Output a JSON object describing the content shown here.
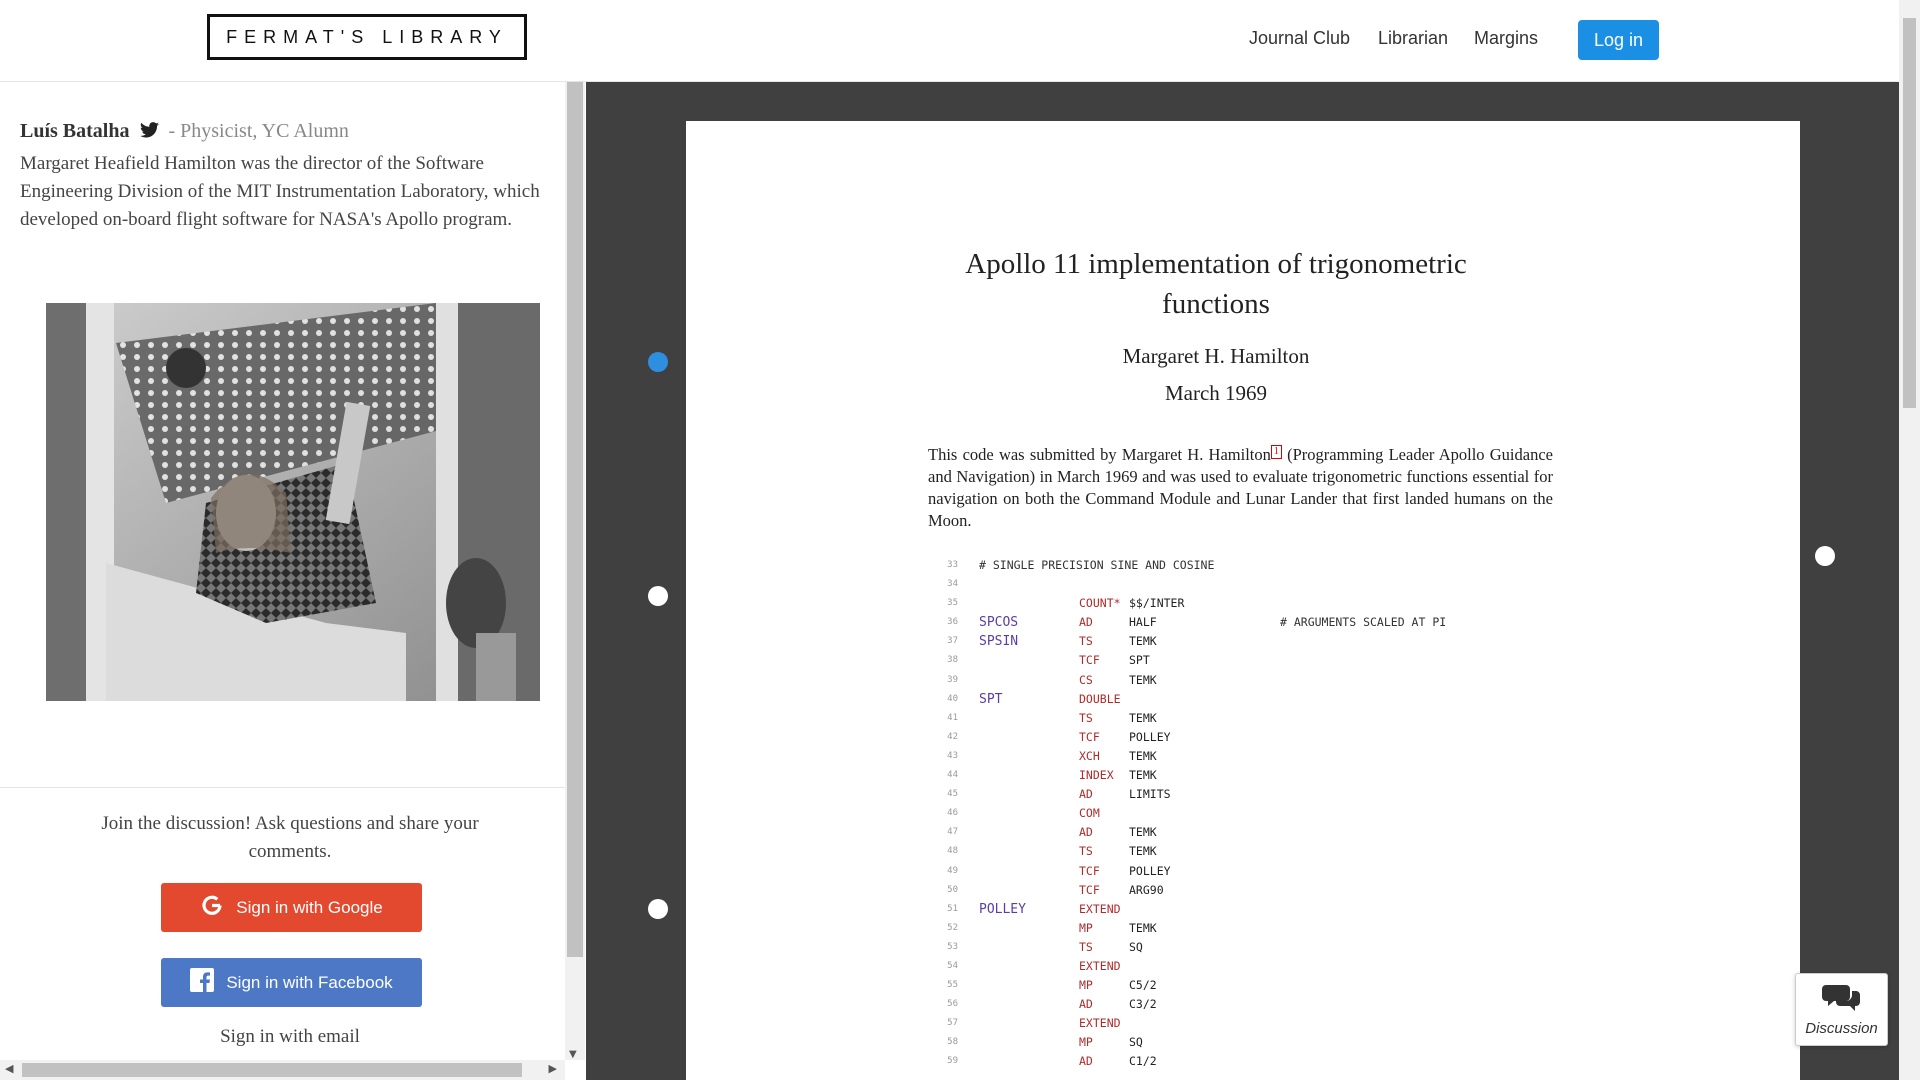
{
  "header": {
    "logo": "FERMAT'S LIBRARY",
    "nav": [
      "Journal Club",
      "Librarian",
      "Margins"
    ],
    "login": "Log in"
  },
  "sidebar": {
    "author_name": "Luís Batalha",
    "author_role": "- Physicist, YC Alumn",
    "bio": "Margaret Heafield Hamilton was the director of the Software Engineering Division of the MIT Instrumentation Laboratory, which developed on-board flight software for NASA's Apollo program.",
    "join_text": "Join the discussion! Ask questions and share your comments.",
    "google_button": "Sign in with Google",
    "facebook_button": "Sign in with Facebook",
    "email_link": "Sign in with email"
  },
  "document": {
    "title": "Apollo 11 implementation of trigonometric functions",
    "author": "Margaret H. Hamilton",
    "date": "March 1969",
    "abstract_before": "This code was submitted by Margaret H. Hamilton",
    "footnote": "1",
    "abstract_after": " (Programming Leader Apollo Guidance and Navigation) in March 1969 and was used to evaluate trigonometric functions essential for navigation on both the Command Module and Lunar Lander that first landed humans on the Moon.",
    "code_lines": [
      {
        "n": "33",
        "comment": "# SINGLE PRECISION SINE AND COSINE"
      },
      {
        "n": "34"
      },
      {
        "n": "35",
        "op": "COUNT*",
        "arg": "$$/INTER"
      },
      {
        "n": "36",
        "label": "SPCOS",
        "op": "AD",
        "arg": "HALF",
        "comment2": "# ARGUMENTS SCALED AT PI"
      },
      {
        "n": "37",
        "label": "SPSIN",
        "op": "TS",
        "arg": "TEMK"
      },
      {
        "n": "38",
        "op": "TCF",
        "arg": "SPT"
      },
      {
        "n": "39",
        "op": "CS",
        "arg": "TEMK"
      },
      {
        "n": "40",
        "label": "SPT",
        "op": "DOUBLE"
      },
      {
        "n": "41",
        "op": "TS",
        "arg": "TEMK"
      },
      {
        "n": "42",
        "op": "TCF",
        "arg": "POLLEY"
      },
      {
        "n": "43",
        "op": "XCH",
        "arg": "TEMK"
      },
      {
        "n": "44",
        "op": "INDEX",
        "arg": "TEMK"
      },
      {
        "n": "45",
        "op": "AD",
        "arg": "LIMITS"
      },
      {
        "n": "46",
        "op": "COM"
      },
      {
        "n": "47",
        "op": "AD",
        "arg": "TEMK"
      },
      {
        "n": "48",
        "op": "TS",
        "arg": "TEMK"
      },
      {
        "n": "49",
        "op": "TCF",
        "arg": "POLLEY"
      },
      {
        "n": "50",
        "op": "TCF",
        "arg": "ARG90"
      },
      {
        "n": "51",
        "label": "POLLEY",
        "op": "EXTEND"
      },
      {
        "n": "52",
        "op": "MP",
        "arg": "TEMK"
      },
      {
        "n": "53",
        "op": "TS",
        "arg": "SQ"
      },
      {
        "n": "54",
        "op": "EXTEND"
      },
      {
        "n": "55",
        "op": "MP",
        "arg": "C5/2"
      },
      {
        "n": "56",
        "op": "AD",
        "arg": "C3/2"
      },
      {
        "n": "57",
        "op": "EXTEND"
      },
      {
        "n": "58",
        "op": "MP",
        "arg": "SQ"
      },
      {
        "n": "59",
        "op": "AD",
        "arg": "C1/2"
      }
    ]
  },
  "discussion_button": "Discussion",
  "colors": {
    "accent": "#1a8fe3",
    "google": "#e2492f",
    "facebook": "#4d78c6",
    "viewer_bg": "#404040",
    "comment_dot_active": "#2e8ee0"
  },
  "icons": [
    "twitter-icon",
    "google-icon",
    "facebook-icon",
    "comments-icon"
  ]
}
